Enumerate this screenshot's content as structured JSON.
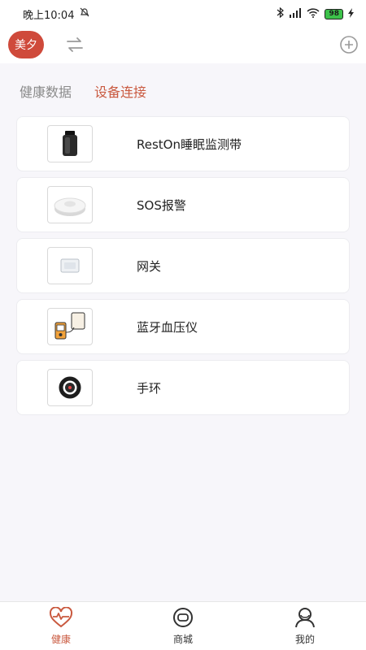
{
  "status_bar": {
    "time": "晚上10:04",
    "battery": "98",
    "icons": [
      "alarm-off-icon",
      "bluetooth-icon",
      "signal-icon",
      "wifi-icon",
      "battery-icon",
      "charging-icon"
    ]
  },
  "header": {
    "avatar_text": "美夕",
    "switch_icon": "swap-arrows-icon",
    "add_icon": "plus-circle-icon"
  },
  "tabs": [
    {
      "label": "健康数据",
      "active": false
    },
    {
      "label": "设备连接",
      "active": true
    }
  ],
  "devices": [
    {
      "name": "RestOn睡眠监测带",
      "icon": "sleep-band-icon"
    },
    {
      "name": "SOS报警",
      "icon": "sos-button-icon"
    },
    {
      "name": "网关",
      "icon": "gateway-icon"
    },
    {
      "name": "蓝牙血压仪",
      "icon": "blood-pressure-monitor-icon"
    },
    {
      "name": "手环",
      "icon": "wristband-icon"
    }
  ],
  "bottom_nav": [
    {
      "label": "健康",
      "icon": "heart-pulse-icon",
      "active": true
    },
    {
      "label": "商城",
      "icon": "store-icon",
      "active": false
    },
    {
      "label": "我的",
      "icon": "profile-icon",
      "active": false
    }
  ],
  "colors": {
    "accent": "#c9593f",
    "avatar_bg": "#cf4a3b",
    "background": "#f7f6fa"
  }
}
